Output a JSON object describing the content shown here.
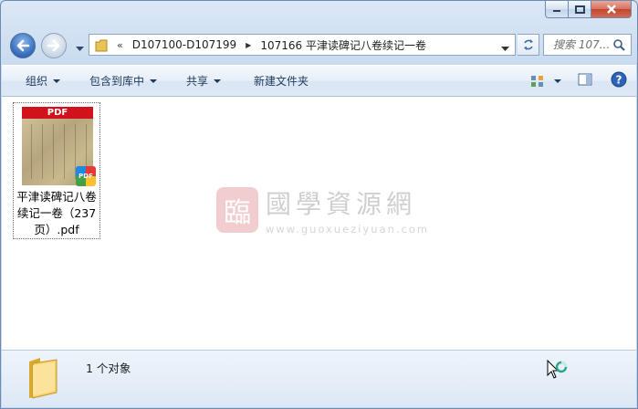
{
  "window": {
    "caption_buttons": [
      "minimize-icon",
      "maximize-icon",
      "close-icon"
    ]
  },
  "address_bar": {
    "overflow_chevron": "«",
    "segments": [
      "D107100-D107199",
      "107166 平津读碑记八卷续记一卷"
    ]
  },
  "search": {
    "placeholder": "搜索 107..."
  },
  "toolbar": {
    "organize": "组织",
    "include_in_library": "包含到库中",
    "share": "共享",
    "new_folder": "新建文件夹"
  },
  "files": [
    {
      "name": "平津读碑记八卷续记一卷（237页）.pdf",
      "name_lines": [
        "平津读碑记八卷",
        "续记一卷（237",
        "页）.pdf"
      ],
      "thumb_banner": "PDF",
      "badge": "PDF"
    }
  ],
  "watermark": {
    "seal": "臨",
    "name": "國學資源網",
    "url": "www.guoxueziyuan.com"
  },
  "status": {
    "count": "1 个对象"
  },
  "colors": {
    "accent": "#1e395b",
    "pdf_red": "#d1111c"
  }
}
